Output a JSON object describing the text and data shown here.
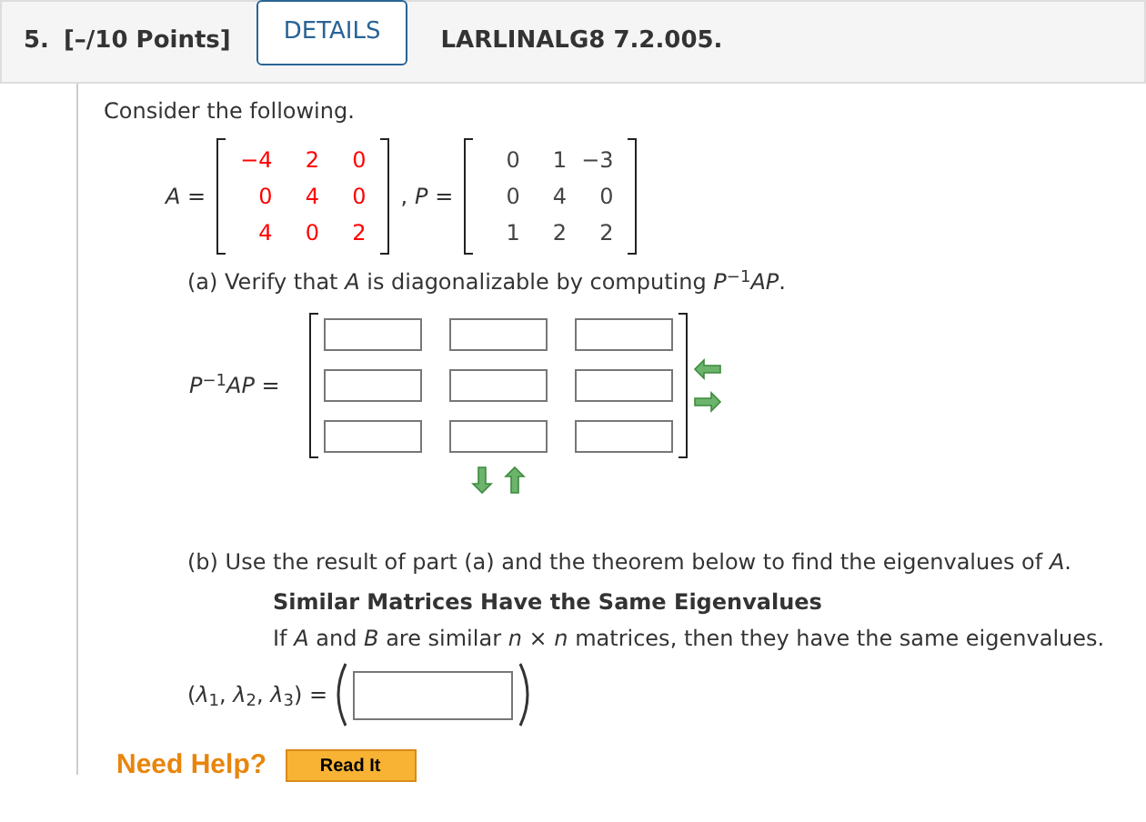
{
  "header": {
    "number": "5.",
    "points": "[–/10 Points]",
    "details_button": "DETAILS",
    "problem_id": "LARLINALG8 7.2.005."
  },
  "intro": "Consider the following.",
  "matrices": [
    {
      "name": "*A* =",
      "color": "#ff0000",
      "rows": [
        [
          "−4",
          "2",
          "0"
        ],
        [
          "0",
          "4",
          "0"
        ],
        [
          "4",
          "0",
          "2"
        ]
      ],
      "after": ","
    },
    {
      "name": "*P* =",
      "color": "#444444",
      "rows": [
        [
          "0",
          "1",
          "−3"
        ],
        [
          "0",
          "4",
          "0"
        ],
        [
          "1",
          "2",
          "2"
        ]
      ]
    }
  ],
  "part_a": {
    "prompt": "(a) Verify that *A* is diagonalizable by computing *P*$^{−1}$*AP*.",
    "answer_label": "*P*$^{−1}$*AP* =",
    "answer_rows": [
      [
        {
          "kind": "input"
        },
        {
          "kind": "input"
        },
        {
          "kind": "input"
        }
      ],
      [
        {
          "kind": "input"
        },
        {
          "kind": "input"
        },
        {
          "kind": "input"
        }
      ],
      [
        {
          "kind": "input"
        },
        {
          "kind": "input"
        },
        {
          "kind": "input"
        }
      ]
    ]
  },
  "part_b": {
    "prompt": "(b) Use the result of part (a) and the theorem below to find the eigenvalues of *A*.",
    "theorem_title": "Similar Matrices Have the Same Eigenvalues",
    "theorem_text": "If *A* and *B* are similar *n* × *n* matrices, then they have the same eigenvalues.",
    "answer_label": "(*λ*$_{1}$, *λ*$_{2}$, *λ*$_{3}$) ="
  },
  "help": {
    "label": "Need Help?",
    "button": "Read It"
  }
}
